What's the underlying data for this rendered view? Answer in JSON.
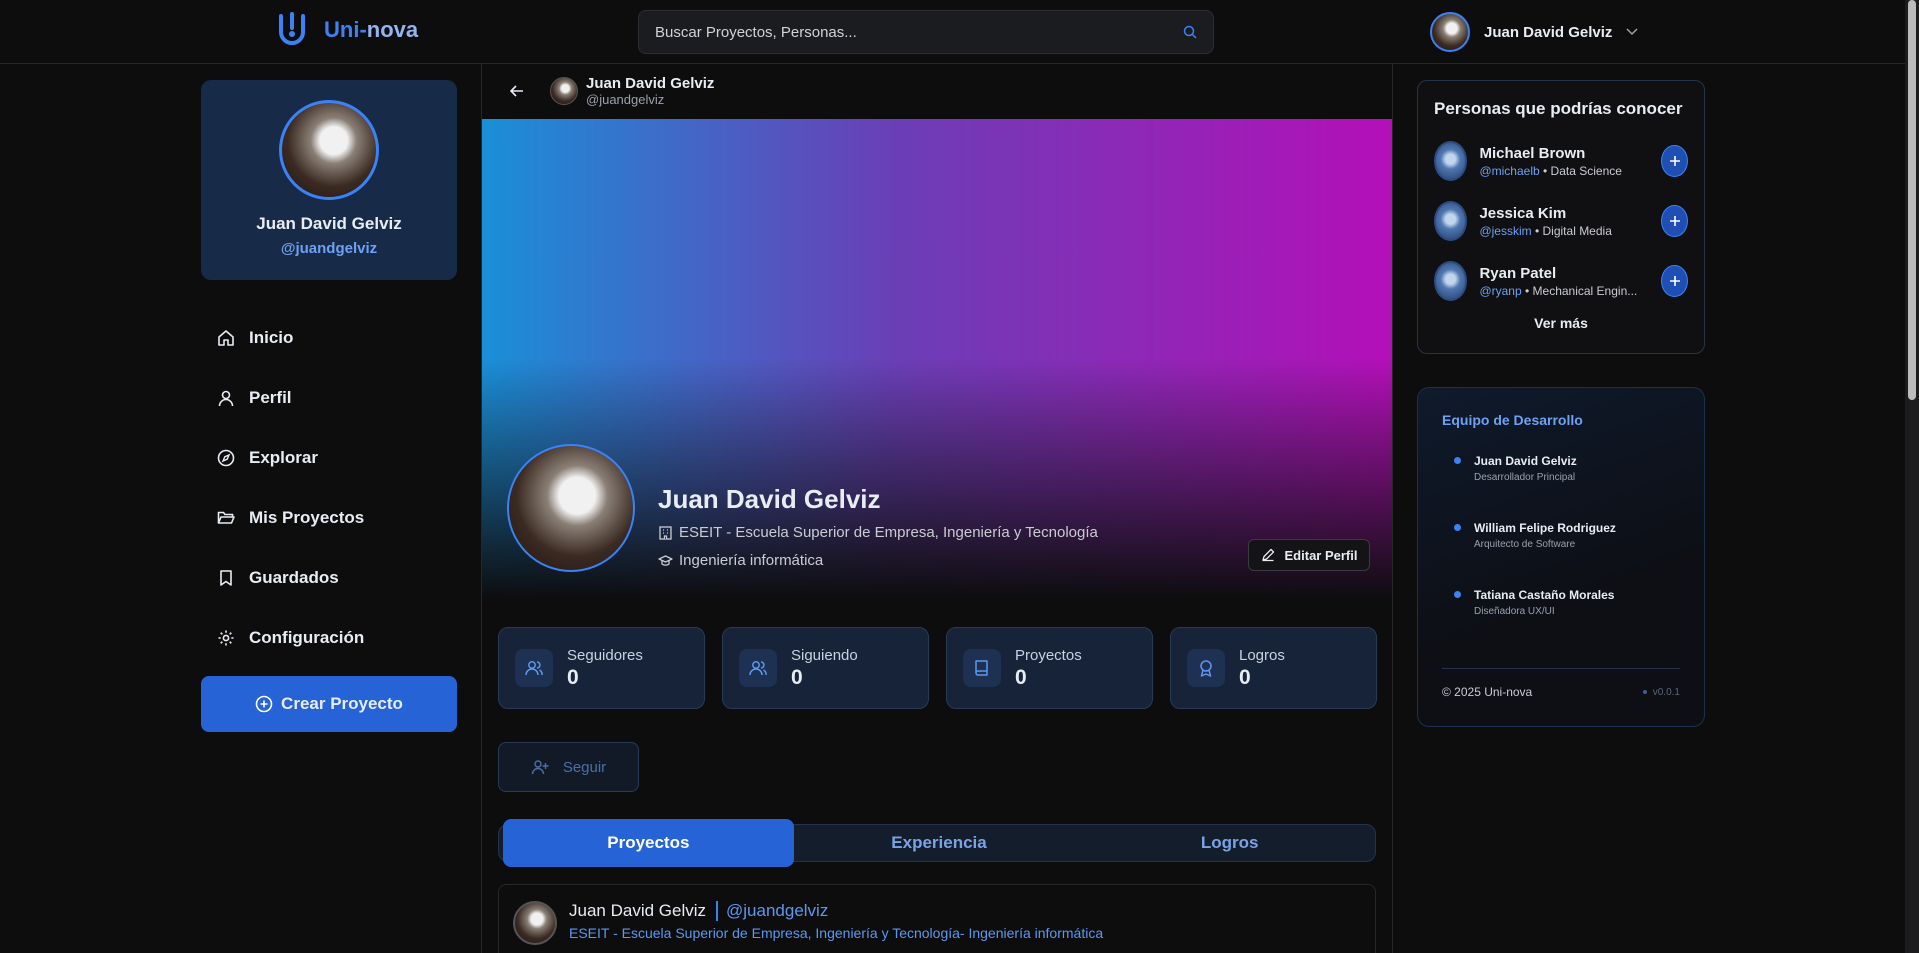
{
  "brand": {
    "name_a": "Uni-",
    "name_b": "nova"
  },
  "search": {
    "placeholder": "Buscar Proyectos, Personas..."
  },
  "user": {
    "name": "Juan David Gelviz",
    "handle": "@juandgelviz"
  },
  "nav": {
    "items": [
      "Inicio",
      "Perfil",
      "Explorar",
      "Mis Proyectos",
      "Guardados",
      "Configuración"
    ],
    "create_label": "Crear Proyecto"
  },
  "profile": {
    "header_name": "Juan David Gelviz",
    "header_handle": "@juandgelviz",
    "name": "Juan David Gelviz",
    "institution": "ESEIT - Escuela Superior de Empresa, Ingeniería y Tecnología",
    "career": "Ingeniería informática",
    "edit_label": "Editar Perfil",
    "follow_label": "Seguir",
    "stats": [
      {
        "label": "Seguidores",
        "value": "0"
      },
      {
        "label": "Siguiendo",
        "value": "0"
      },
      {
        "label": "Proyectos",
        "value": "0"
      },
      {
        "label": "Logros",
        "value": "0"
      }
    ],
    "tabs": [
      "Proyectos",
      "Experiencia",
      "Logros"
    ]
  },
  "post": {
    "name": "Juan David Gelviz",
    "handle": "@juandgelviz",
    "info": "ESEIT - Escuela Superior de Empresa, Ingeniería y Tecnología- Ingeniería informática"
  },
  "suggestions": {
    "title": "Personas que podrías conocer",
    "people": [
      {
        "name": "Michael Brown",
        "handle": "@michaelb",
        "area": " • Data Science"
      },
      {
        "name": "Jessica Kim",
        "handle": "@jesskim",
        "area": " • Digital Media"
      },
      {
        "name": "Ryan Patel",
        "handle": "@ryanp",
        "area": " • Mechanical Engin..."
      }
    ],
    "more": "Ver más"
  },
  "team": {
    "title": "Equipo de Desarrollo",
    "members": [
      {
        "name": "Juan David Gelviz",
        "role": "Desarrollador Principal"
      },
      {
        "name": "William Felipe Rodriguez",
        "role": "Arquitecto de Software"
      },
      {
        "name": "Tatiana Castaño Morales",
        "role": "Diseñadora UX/UI"
      }
    ],
    "copyright": "© 2025 Uni-nova",
    "version": "v0.0.1"
  },
  "colors": {
    "accent": "#2563d6",
    "link": "#6ea1f1",
    "bg": "#0d0d0e"
  }
}
